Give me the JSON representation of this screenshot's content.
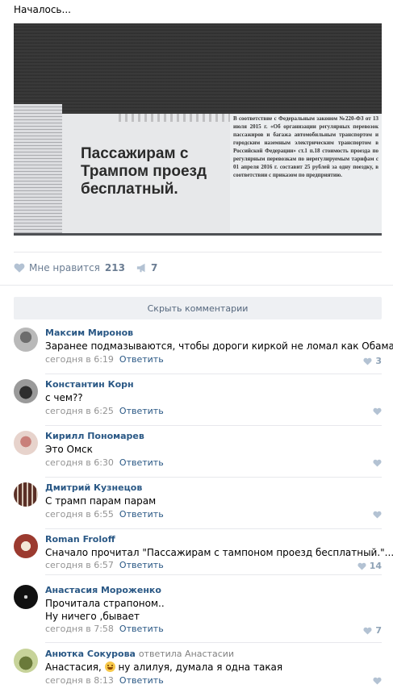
{
  "post": {
    "text": "Началось...",
    "photo": {
      "sign_text": "Пассажирам с Трампом проезд бесплатный.",
      "notice_text": "В соответствие с Федеральным законом №220-ФЗ от 13 июля 2015 г. «Об организации регулярных перевозок пассажиров и багажа автомобильным транспортом и городским наземным электрическим транспортом в Российской Федерации» ст.1 п.18 стоимость проезда по регулярным перевозкам по нерегулируемым тарифам с 01 апреля 2016 г. составит 25 рублей за одну поездку, в соответствии с приказом по предприятию."
    },
    "actions": {
      "like_label": "Мне нравится",
      "like_count": "213",
      "share_count": "7"
    }
  },
  "comments_toggle": "Скрыть комментарии",
  "colors": {
    "link": "#2a5885",
    "meta": "#939393",
    "action_gray": "#6b7d93",
    "like_icon": "#8ea2b6",
    "button_bg": "#eef0f3"
  },
  "comments": [
    {
      "author": "Максим Миронов",
      "text": "Заранее подмазываются, чтобы дороги киркой не ломал как Обама.",
      "time": "сегодня в 6:19",
      "reply": "Ответить",
      "likes": "3",
      "avatar_icon": "user-avatar"
    },
    {
      "author": "Константин Корн",
      "text": "с чем??",
      "time": "сегодня в 6:25",
      "reply": "Ответить",
      "likes": "",
      "avatar_icon": "user-avatar"
    },
    {
      "author": "Кирилл Пономарев",
      "text": "Это Омск",
      "time": "сегодня в 6:30",
      "reply": "Ответить",
      "likes": "",
      "avatar_icon": "user-avatar"
    },
    {
      "author": "Дмитрий Кузнецов",
      "text": "С трамп парам парам",
      "time": "сегодня в 6:55",
      "reply": "Ответить",
      "likes": "",
      "avatar_icon": "user-avatar"
    },
    {
      "author": "Roman Froloff",
      "text": "Сначало прочитал \"Пассажирам с тампоном проезд бесплатный.\"...",
      "time": "сегодня в 6:57",
      "reply": "Ответить",
      "likes": "14",
      "avatar_icon": "user-avatar"
    },
    {
      "author": "Анастасия Мороженко",
      "text_line1": "Прочитала страпоном..",
      "text_line2": "Ну ничего ,бывает",
      "time": "сегодня в 7:58",
      "reply": "Ответить",
      "likes": "7",
      "avatar_icon": "user-avatar"
    },
    {
      "author": "Анютка Сокурова",
      "reply_to": "ответила Анастасии",
      "text_before": "Анастасия,",
      "text_after": "ну алилуя, думала я одна такая",
      "time": "сегодня в 8:13",
      "reply": "Ответить",
      "likes": "",
      "avatar_icon": "user-avatar"
    }
  ]
}
